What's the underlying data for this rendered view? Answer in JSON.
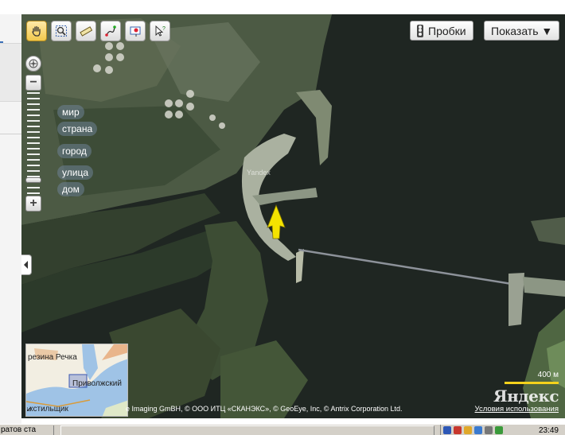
{
  "toolbar": {
    "tools": [
      {
        "name": "hand-tool",
        "icon": "hand-icon",
        "active": true
      },
      {
        "name": "zoom-area-tool",
        "icon": "magnifier-icon",
        "active": false
      },
      {
        "name": "ruler-tool",
        "icon": "ruler-icon",
        "active": false
      },
      {
        "name": "route-tool",
        "icon": "route-icon",
        "active": false
      },
      {
        "name": "placemark-tool",
        "icon": "placemark-icon",
        "active": false
      },
      {
        "name": "info-cursor-tool",
        "icon": "cursor-question-icon",
        "active": false
      }
    ]
  },
  "traffic_button": {
    "label": "Пробки",
    "icon": "traffic-light-icon"
  },
  "show_button": {
    "label": "Показать ▼"
  },
  "zoom": {
    "levels": [
      "мир",
      "страна",
      "город",
      "улица",
      "дом"
    ],
    "level_fraction": 0.9
  },
  "map": {
    "watermark": "Yandex",
    "scale_label": "400 м",
    "brand": "Яндекс",
    "copyright": "e Imaging GmBH, © ООО ИТЦ «СКАНЭКС», © GeoEye, Inc, © Antrix Corporation Ltd.",
    "terms_link": "Условия использования"
  },
  "minimap": {
    "labels": [
      "резина Речка",
      "Приволжский",
      "кстильщик"
    ]
  },
  "taskbar": {
    "task_label": "ратов ста",
    "clock": "23:49"
  },
  "colors": {
    "water": "#1f2622",
    "scale_bar": "#f4d21c",
    "arrow": "#f5e300"
  }
}
